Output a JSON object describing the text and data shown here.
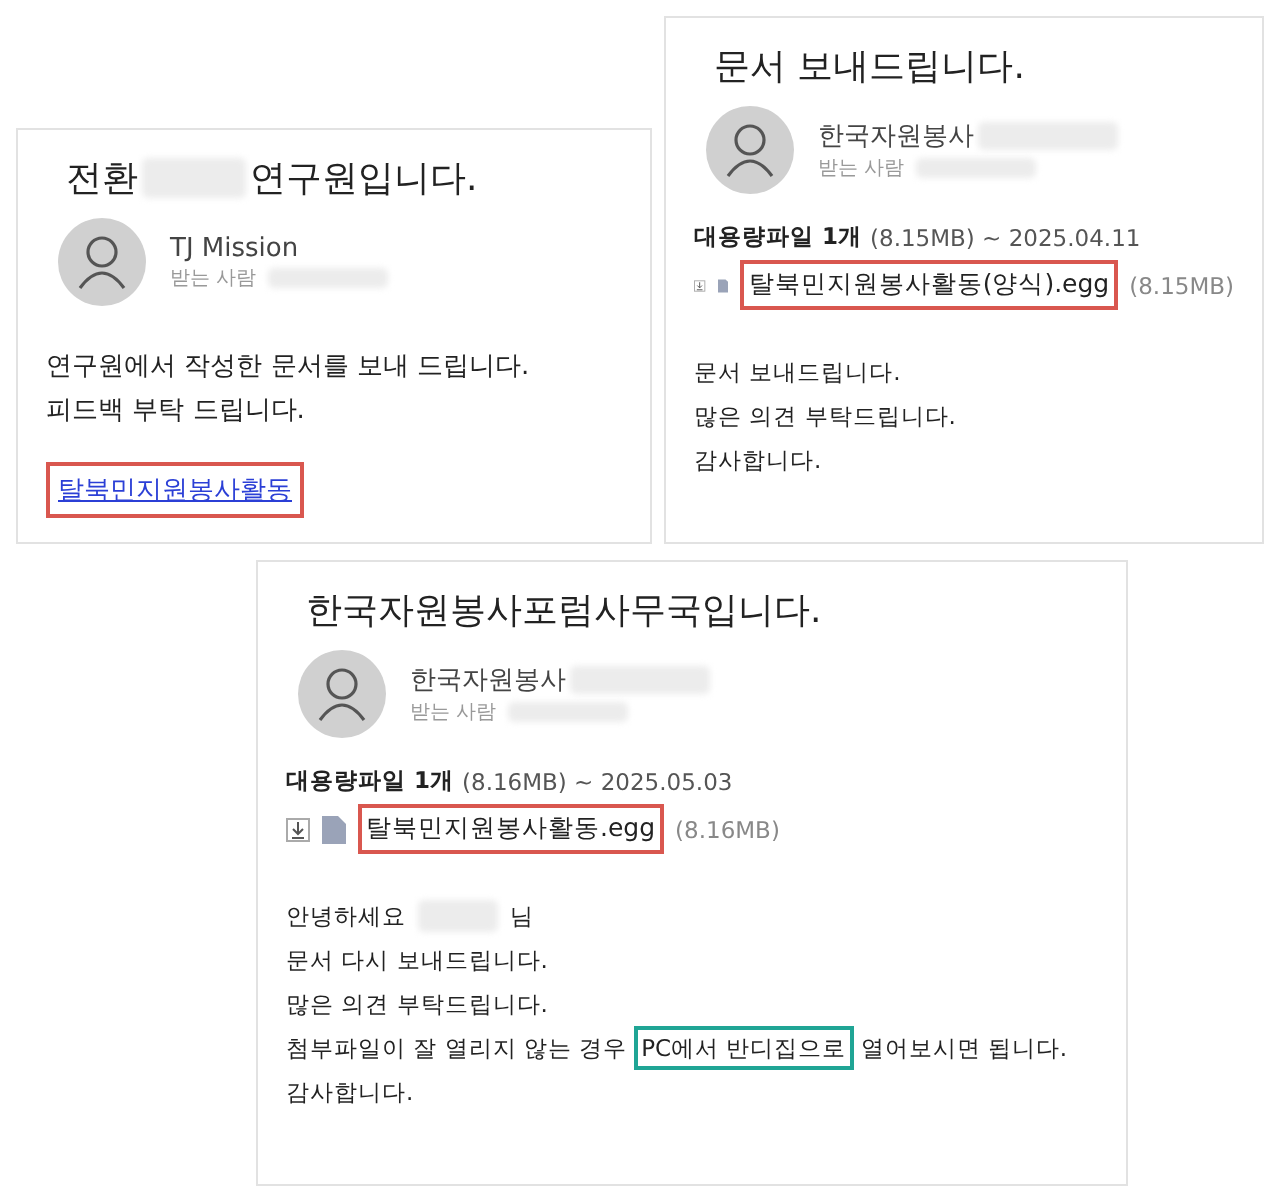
{
  "emails": [
    {
      "subject": [
        {
          "kind": "text",
          "text": "전환"
        },
        {
          "kind": "redacted"
        },
        {
          "kind": "text",
          "text": "연구원입니다."
        }
      ],
      "sender": "TJ Mission",
      "recipient_label": "받는 사람",
      "body": [
        [
          {
            "kind": "text",
            "text": "연구원에서 작성한 문서를 보내 드립니다."
          }
        ],
        [
          {
            "kind": "text",
            "text": "피드백 부탁 드립니다."
          }
        ]
      ],
      "link": {
        "text": "탈북민지원봉사활동",
        "color": "#d9574f"
      }
    },
    {
      "subject": [
        {
          "kind": "text",
          "text": "문서 보내드립니다."
        }
      ],
      "sender": "한국자원봉사",
      "recipient_label": "받는 사람",
      "attachment": {
        "heading": "대용량파일 1개",
        "size": "(8.15MB) ~ 2025.04.11",
        "file": "탈북민지원봉사활동(양식).egg",
        "file_size": "(8.15MB)",
        "color": "#d9574f"
      },
      "body": [
        [
          {
            "kind": "text",
            "text": "문서 보내드립니다."
          }
        ],
        [
          {
            "kind": "text",
            "text": "많은 의견 부탁드립니다."
          }
        ],
        [
          {
            "kind": "text",
            "text": "감사합니다."
          }
        ]
      ]
    },
    {
      "subject": [
        {
          "kind": "text",
          "text": "한국자원봉사포럼사무국입니다."
        }
      ],
      "sender": "한국자원봉사",
      "recipient_label": "받는 사람",
      "attachment": {
        "heading": "대용량파일 1개",
        "size": "(8.16MB) ~ 2025.05.03",
        "file": "탈북민지원봉사활동.egg",
        "file_size": "(8.16MB)",
        "color": "#d9574f"
      },
      "body": [
        [
          {
            "kind": "text",
            "text": "안녕하세요"
          },
          {
            "kind": "redacted"
          },
          {
            "kind": "text",
            "text": "님"
          }
        ],
        [
          {
            "kind": "text",
            "text": "문서 다시 보내드립니다."
          }
        ],
        [
          {
            "kind": "text",
            "text": "많은 의견 부탁드립니다."
          }
        ],
        [
          {
            "kind": "text",
            "text": "첨부파일이 잘 열리지 않는 경우"
          },
          {
            "kind": "highlight",
            "text": "PC에서 반디집으로",
            "color": "#1fa595"
          },
          {
            "kind": "text",
            "text": "열어보시면 됩니다."
          }
        ],
        [
          {
            "kind": "text",
            "text": "감사합니다."
          }
        ]
      ]
    }
  ]
}
